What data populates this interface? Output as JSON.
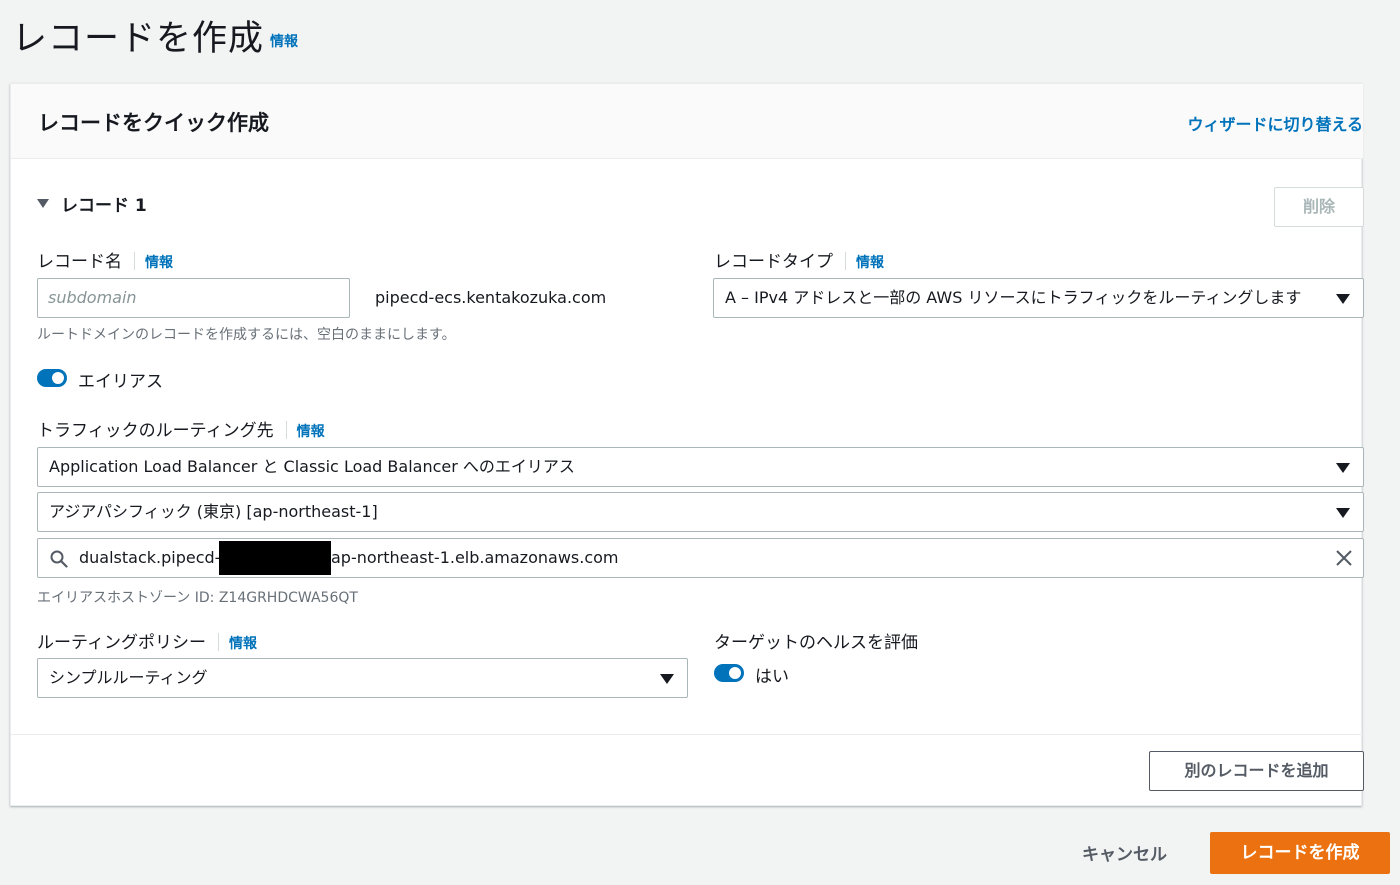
{
  "page": {
    "title": "レコードを作成",
    "info": "情報"
  },
  "card": {
    "title": "レコードをクイック作成",
    "wizard_link": "ウィザードに切り替える",
    "record_header": "レコード 1",
    "delete_label": "削除",
    "add_record_label": "別のレコードを追加"
  },
  "record_name": {
    "label": "レコード名",
    "info": "情報",
    "placeholder": "subdomain",
    "value": "",
    "domain_suffix": "pipecd-ecs.kentakozuka.com",
    "hint": "ルートドメインのレコードを作成するには、空白のままにします。"
  },
  "record_type": {
    "label": "レコードタイプ",
    "info": "情報",
    "value": "A – IPv4 アドレスと一部の AWS リソースにトラフィックをルーティングします"
  },
  "alias": {
    "label": "エイリアス",
    "enabled": true
  },
  "routing_target": {
    "label": "トラフィックのルーティング先",
    "info": "情報",
    "endpoint_type": "Application Load Balancer と Classic Load Balancer へのエイリアス",
    "region": "アジアパシフィック (東京) [ap-northeast-1]",
    "dns_prefix": "dualstack.pipecd-",
    "dns_suffix": "ap-northeast-1.elb.amazonaws.com",
    "hosted_zone": "エイリアスホストゾーン ID: Z14GRHDCWA56QT"
  },
  "routing_policy": {
    "label": "ルーティングポリシー",
    "info": "情報",
    "value": "シンプルルーティング"
  },
  "health": {
    "label": "ターゲットのヘルスを評価",
    "toggle_label": "はい",
    "enabled": true
  },
  "footer": {
    "cancel_label": "キャンセル",
    "create_label": "レコードを作成"
  },
  "colors": {
    "link": "#0073bb",
    "primary_button": "#ec7211",
    "toggle_on": "#0073bb"
  }
}
